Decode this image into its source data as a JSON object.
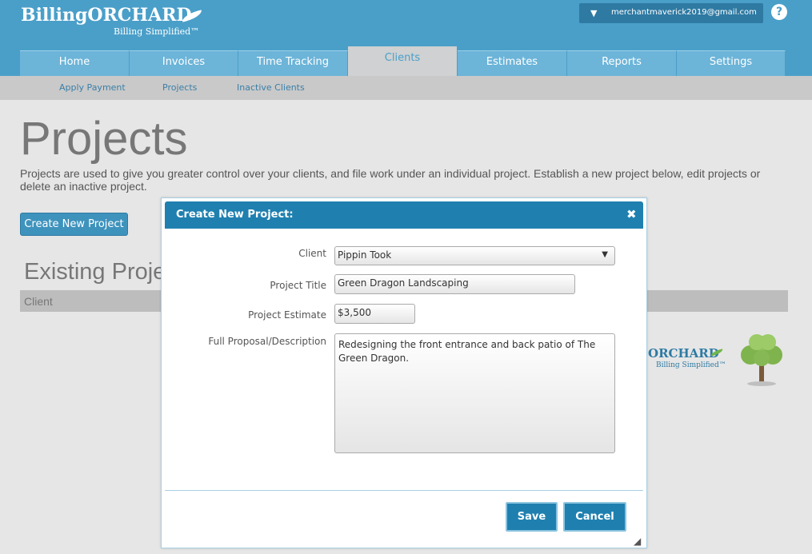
{
  "brand": {
    "name_prefix": "Billing",
    "name_suffix": "ORCHARD",
    "tagline": "Billing Simplified™"
  },
  "account": {
    "email": "merchantmaverick2019@gmail.com",
    "help_label": "?"
  },
  "nav": {
    "tabs": [
      {
        "label": "Home"
      },
      {
        "label": "Invoices"
      },
      {
        "label": "Time Tracking"
      },
      {
        "label": "Clients",
        "active": true
      },
      {
        "label": "Estimates"
      },
      {
        "label": "Reports"
      },
      {
        "label": "Settings"
      }
    ]
  },
  "subnav": {
    "items": [
      {
        "label": "Apply Payment"
      },
      {
        "label": "Projects"
      },
      {
        "label": "Inactive Clients"
      }
    ]
  },
  "page": {
    "title": "Projects",
    "description": "Projects are used to give you greater control over your clients, and file work under an individual project. Establish a new project below, edit projects or delete an inactive project.",
    "create_button": "Create New Project",
    "existing_title": "Existing Projects",
    "table_columns": [
      "Client"
    ]
  },
  "modal": {
    "title": "Create New Project:",
    "close_label": "✖",
    "client_label": "Client",
    "client_value": "Pippin Took",
    "project_title_label": "Project Title",
    "project_title_value": "Green Dragon Landscaping",
    "estimate_label": "Project Estimate",
    "estimate_value": "$3,500",
    "description_label": "Full Proposal/Description",
    "description_value": "Redesigning the front entrance and back patio of The Green Dragon.",
    "save_label": "Save",
    "cancel_label": "Cancel"
  },
  "colors": {
    "header": "#4a9fc9",
    "modal_header": "#1f80b0",
    "button": "#3e93bd"
  }
}
